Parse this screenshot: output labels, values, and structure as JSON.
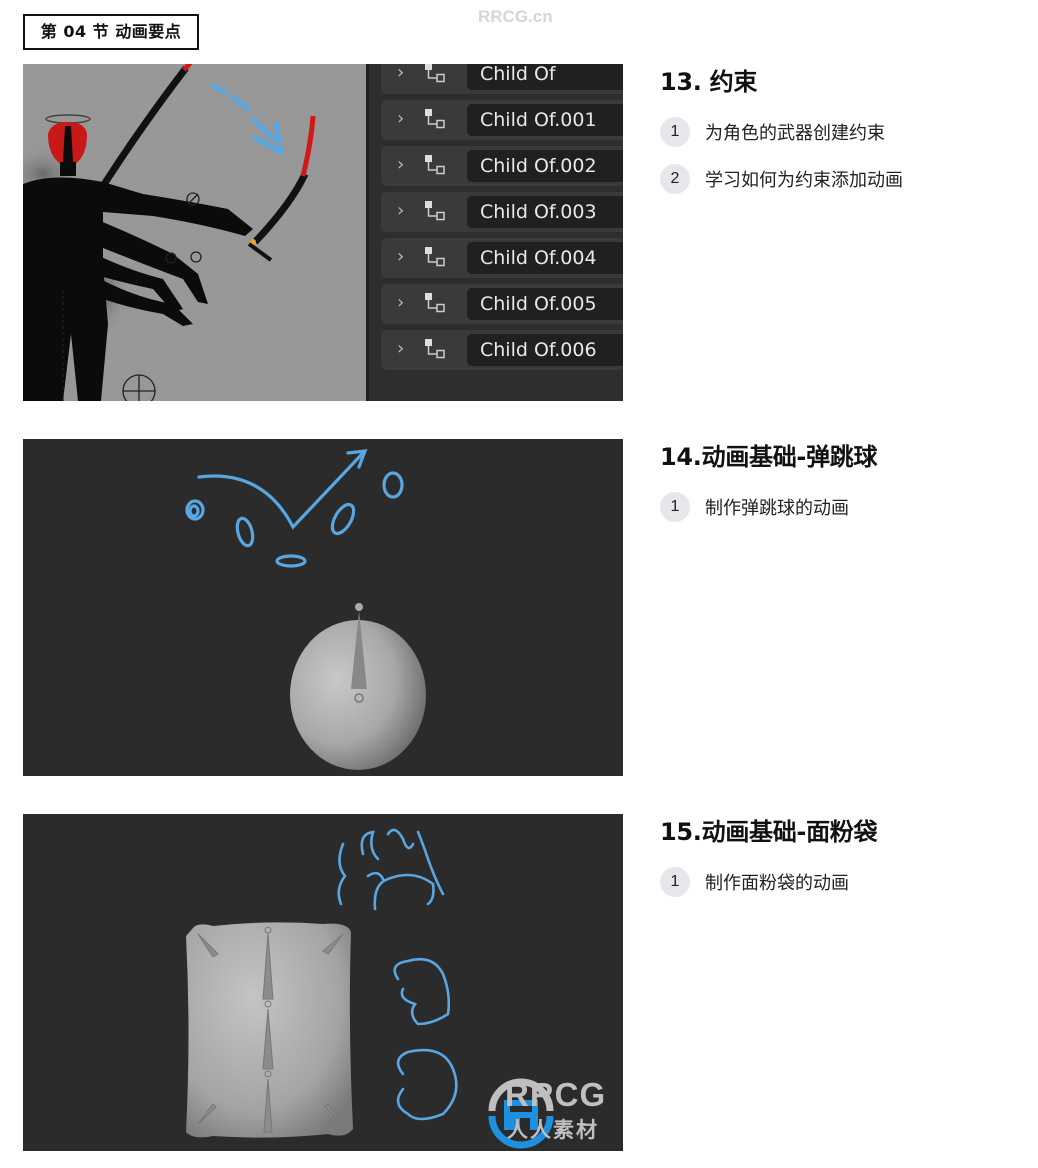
{
  "header": {
    "section_label": "第 04 节 动画要点",
    "site_watermark": "RRCG.cn"
  },
  "lessons": [
    {
      "title": "13. 约束",
      "items": [
        {
          "num": "1",
          "text": "为角色的武器创建约束"
        },
        {
          "num": "2",
          "text": "学习如何为约束添加动画"
        }
      ],
      "image": {
        "description": "Character with weapon and Blender constraint panel",
        "constraints": [
          {
            "name": "Child Of"
          },
          {
            "name": "Child Of.001"
          },
          {
            "name": "Child Of.002"
          },
          {
            "name": "Child Of.003"
          },
          {
            "name": "Child Of.004"
          },
          {
            "name": "Child Of.005"
          },
          {
            "name": "Child Of.006"
          }
        ]
      }
    },
    {
      "title": "14.动画基础-弹跳球",
      "items": [
        {
          "num": "1",
          "text": "制作弹跳球的动画"
        }
      ],
      "image": {
        "description": "Bouncing ball with sketch annotations"
      }
    },
    {
      "title": "15.动画基础-面粉袋",
      "items": [
        {
          "num": "1",
          "text": "制作面粉袋的动画"
        }
      ],
      "image": {
        "description": "Flour sack rig with sketch poses"
      }
    }
  ],
  "logo": {
    "word": "RRCG",
    "cn": "人人素材"
  },
  "colors": {
    "sketch_blue": "#5aa6e0",
    "viewport_dark": "#2b2b2b",
    "accent_red": "#d01818",
    "bullet_bg": "#e6e6eb"
  }
}
